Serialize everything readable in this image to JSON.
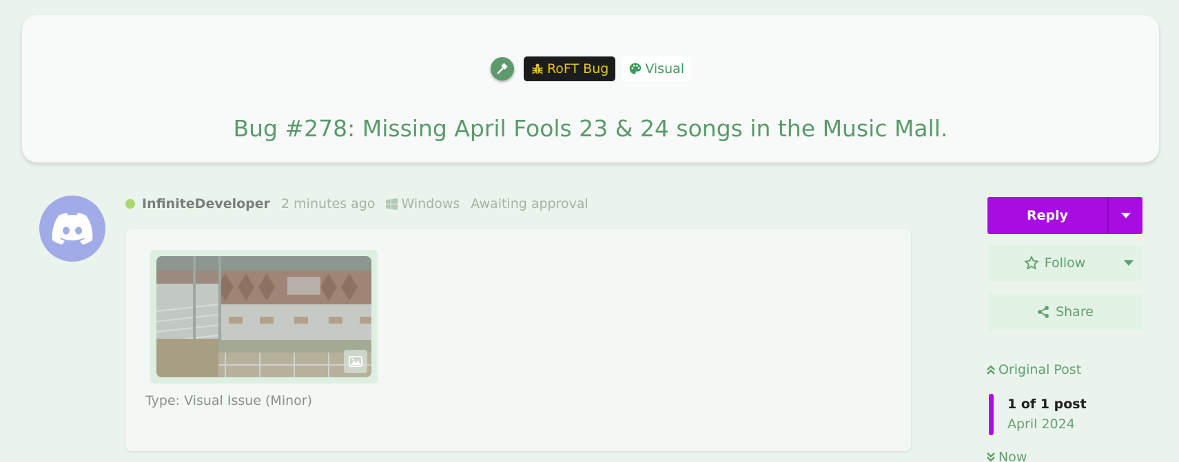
{
  "thread": {
    "tag_bug": "RoFT Bug",
    "tag_visual": "Visual",
    "title": "Bug #278: Missing April Fools 23 & 24 songs in the Music Mall."
  },
  "post": {
    "username": "InfiniteDeveloper",
    "time": "2 minutes ago",
    "os": "Windows",
    "status": "Awaiting approval",
    "type_text": "Type: Visual Issue (Minor)"
  },
  "sidebar": {
    "reply_label": "Reply",
    "follow_label": "Follow",
    "share_label": "Share",
    "original_post_label": "Original Post",
    "post_count": "1 of 1 post",
    "date": "April 2024",
    "now_label": "Now"
  },
  "colors": {
    "accent": "#a80ce0",
    "green": "#5f9f6f",
    "bug_badge_text": "#e3c421",
    "avatar_bg": "#a0abe8"
  },
  "icons": [
    "hammer-icon",
    "bug-icon",
    "palette-icon",
    "windows-icon",
    "discord-icon",
    "image-icon",
    "caret-down-icon",
    "star-icon",
    "share-icon",
    "chevron-up-double-icon",
    "chevron-down-double-icon"
  ]
}
